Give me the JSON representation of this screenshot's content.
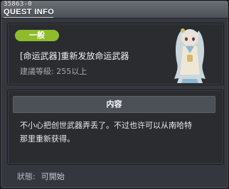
{
  "window": {
    "quest_id": "35863-0",
    "title": "QUEST INFO"
  },
  "quest": {
    "category_tag": "一般",
    "name": "[命运武器]重新发放命运武器",
    "recommended_level": "建議等級: 255以上",
    "npc_icon": "npc-silver-haired-girl-icon"
  },
  "content": {
    "header": "内容",
    "description_line1": "不小心把创世武器弄丢了。不过也许可以从南哈特",
    "description_line2": "那里重新获得。"
  },
  "status": {
    "label": "狀態:",
    "value": "可開始"
  },
  "colors": {
    "tag_green": "#8fbc2c",
    "panel_bg": "#2a2c30",
    "window_bg": "#34373d"
  }
}
